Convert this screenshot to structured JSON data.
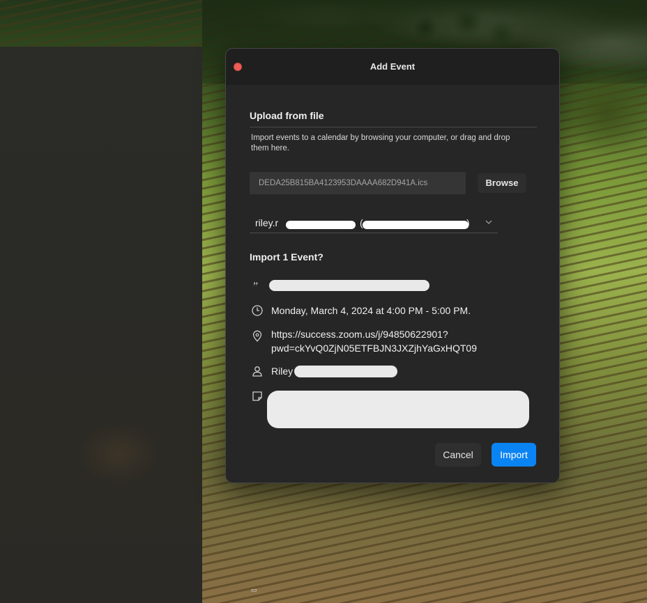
{
  "dialog": {
    "title": "Add Event",
    "section_heading": "Upload from file",
    "description": "Import events to a calendar by browsing your computer, or drag and drop them here.",
    "file_name": "DEDA25B815BA4123953DAAAA682D941A.ics",
    "browse_label": "Browse",
    "calendar_value": "riley.r",
    "calendar_paren": "(",
    "calendar_paren_close": ")",
    "question": "Import 1 Event?",
    "event_datetime": "Monday, March 4, 2024 at 4:00 PM - 5:00 PM.",
    "event_location_line1": "https://success.zoom.us/j/94850622901?",
    "event_location_line2": "pwd=ckYvQ0ZjN05ETFBJN3JXZjhYaGxHQT09",
    "event_organizer": "Riley",
    "cancel_label": "Cancel",
    "import_label": "Import"
  },
  "icons": {
    "title": "quote-icon",
    "time": "clock-icon",
    "location": "location-pin-icon",
    "organizer": "person-icon",
    "notes": "note-icon",
    "close": "close-icon",
    "dropdown": "chevron-down-icon"
  },
  "colors": {
    "accent": "#0b84f3",
    "close": "#ee5d55",
    "dialog_bg": "#262626"
  }
}
